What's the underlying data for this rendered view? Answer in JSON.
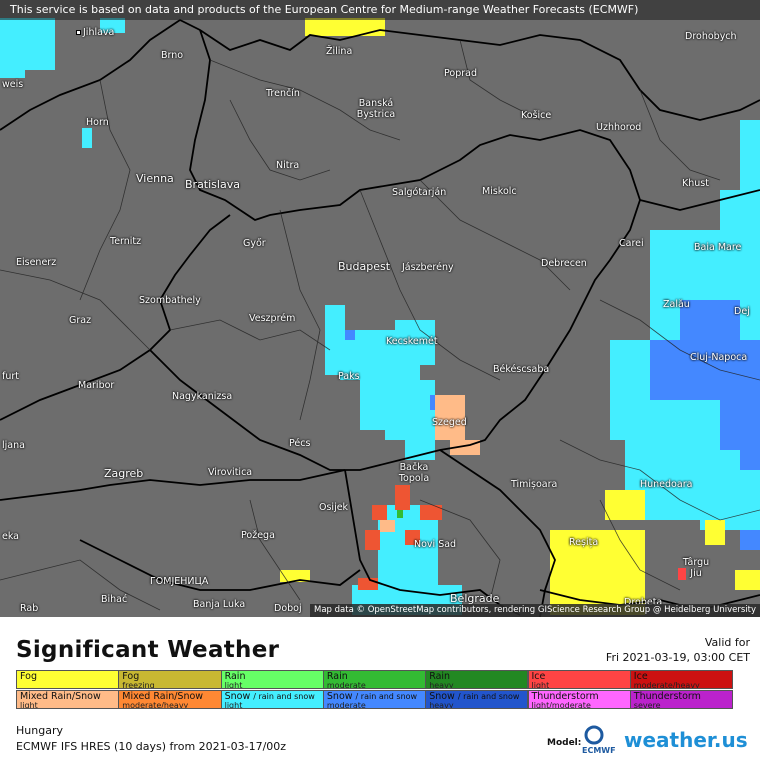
{
  "notice": "This service is based on data and products of the European Centre for Medium-range Weather Forecasts (ECMWF)",
  "attribution": "Map data © OpenStreetMap contributors, rendering GIScience Research Group @ Heidelberg University",
  "cities": [
    {
      "name": "Jihlava"
    },
    {
      "name": "Brno"
    },
    {
      "name": "Žilina"
    },
    {
      "name": "Poprad"
    },
    {
      "name": "Drohobych"
    },
    {
      "name": "weis"
    },
    {
      "name": "Trenčín"
    },
    {
      "name": "Banská Bystrica"
    },
    {
      "name": "Košice"
    },
    {
      "name": "Uzhhorod"
    },
    {
      "name": "Horn"
    },
    {
      "name": "Nitra"
    },
    {
      "name": "Vienna"
    },
    {
      "name": "Bratislava"
    },
    {
      "name": "Salgótarján"
    },
    {
      "name": "Miskolc"
    },
    {
      "name": "Khust"
    },
    {
      "name": "Ternitz"
    },
    {
      "name": "Győr"
    },
    {
      "name": "Carei"
    },
    {
      "name": "Baia Mare"
    },
    {
      "name": "Eisenerz"
    },
    {
      "name": "Budapest"
    },
    {
      "name": "Jászberény"
    },
    {
      "name": "Debrecen"
    },
    {
      "name": "Szombathely"
    },
    {
      "name": "Zalău"
    },
    {
      "name": "Graz"
    },
    {
      "name": "Veszprém"
    },
    {
      "name": "Dej"
    },
    {
      "name": "Kecskemét"
    },
    {
      "name": "Cluj-Napoca"
    },
    {
      "name": "furt"
    },
    {
      "name": "Paks"
    },
    {
      "name": "Maribor"
    },
    {
      "name": "Békéscsaba"
    },
    {
      "name": "Nagykanizsa"
    },
    {
      "name": "Szeged"
    },
    {
      "name": "ljana"
    },
    {
      "name": "Pécs"
    },
    {
      "name": "Bačka Topola"
    },
    {
      "name": "Zagreb"
    },
    {
      "name": "Virovitica"
    },
    {
      "name": "Timișoara"
    },
    {
      "name": "Hunedoara"
    },
    {
      "name": "Osijek"
    },
    {
      "name": "eka"
    },
    {
      "name": "Požega"
    },
    {
      "name": "Novi Sad"
    },
    {
      "name": "Reșița"
    },
    {
      "name": "Târgu Jiu"
    },
    {
      "name": "ГОМЈЕНИЦА"
    },
    {
      "name": "Bihać"
    },
    {
      "name": "Banja Luka"
    },
    {
      "name": "Doboj"
    },
    {
      "name": "Belgrade"
    },
    {
      "name": "Drobeta"
    },
    {
      "name": "Rab"
    }
  ],
  "legend": {
    "title": "Significant Weather",
    "valid_for": "Valid for",
    "valid_time": "Fri 2021-03-19, 03:00 CET",
    "items": [
      {
        "main": "Fog",
        "sub": "",
        "color": "#ffff33"
      },
      {
        "main": "Fog",
        "sub": "freezing",
        "color": "#c8b832"
      },
      {
        "main": "Rain",
        "sub": "light",
        "color": "#66ff66"
      },
      {
        "main": "Rain",
        "sub": "moderate",
        "color": "#33bb33"
      },
      {
        "main": "Rain",
        "sub": "heavy",
        "color": "#228822"
      },
      {
        "main": "Ice",
        "sub": "light",
        "color": "#ff4444"
      },
      {
        "main": "Ice",
        "sub": "moderate/heavy",
        "color": "#cc1111"
      },
      {
        "main": "Mixed Rain/Snow",
        "sub": "light",
        "color": "#ffbb88"
      },
      {
        "main": "Mixed Rain/Snow",
        "sub": "moderate/heavy",
        "color": "#ff8833"
      },
      {
        "main": "Snow / rain and snow",
        "sub": "light",
        "color": "#44eeff"
      },
      {
        "main": "Snow / rain and snow",
        "sub": "moderate",
        "color": "#4488ff"
      },
      {
        "main": "Snow / rain and snow",
        "sub": "heavy",
        "color": "#2255cc"
      },
      {
        "main": "Thunderstorm",
        "sub": "light/moderate",
        "color": "#ff66ff"
      },
      {
        "main": "Thunderstorm",
        "sub": "severe",
        "color": "#bb22cc"
      }
    ],
    "region": "Hungary",
    "model_run": "ECMWF IFS HRES (10 days) from 2021-03-17/00z",
    "model_caption": "Model:",
    "ecmwf_label": "ECMWF",
    "brand": "weather.us"
  },
  "colors": {
    "map_bg": "#6d6d6d",
    "snow_light": "#44eeff",
    "snow_moderate": "#4488ff",
    "fog": "#ffff33",
    "ice": "#ff4444",
    "mixed": "#ff8833",
    "mixed_light": "#ffbb88"
  }
}
